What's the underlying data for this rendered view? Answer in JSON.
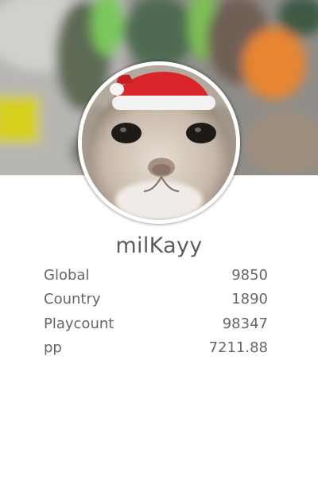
{
  "profile": {
    "username": "milKayy"
  },
  "stats": [
    {
      "label": "Global",
      "value": "9850"
    },
    {
      "label": "Country",
      "value": "1890"
    },
    {
      "label": "Playcount",
      "value": "98347"
    },
    {
      "label": "pp",
      "value": "7211.88"
    }
  ],
  "colors": {
    "text": "#666666",
    "username": "#5d5d5d",
    "background": "#ffffff",
    "santa_hat": "#d8262b"
  }
}
